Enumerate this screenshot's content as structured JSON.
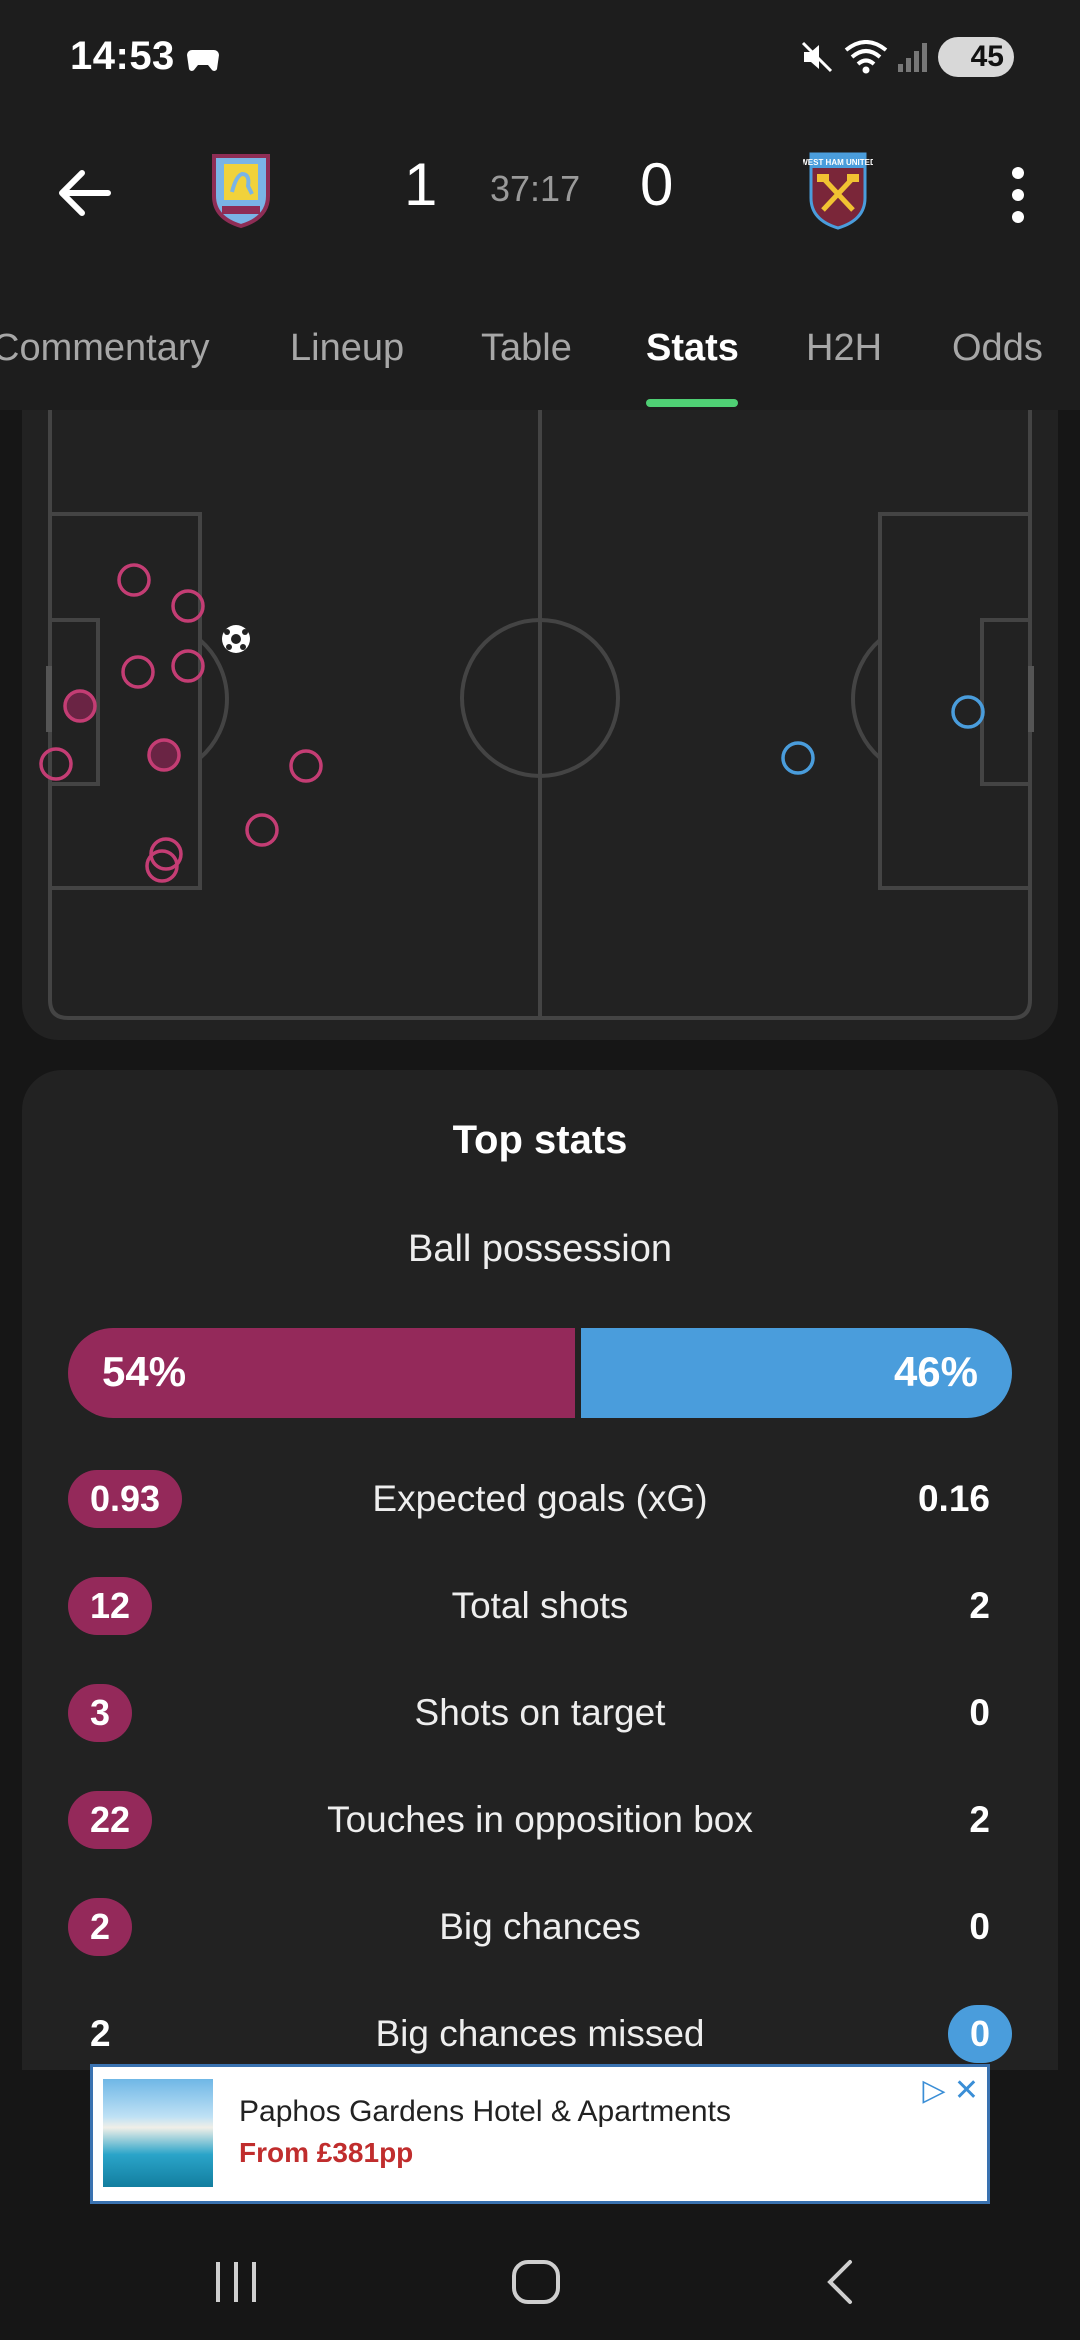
{
  "status_bar": {
    "time": "14:53",
    "battery": "45",
    "icons": [
      "game-controller-icon",
      "mute-icon",
      "wifi-icon",
      "signal-icon",
      "battery-icon"
    ]
  },
  "match": {
    "home_score": "1",
    "away_score": "0",
    "clock": "37:17",
    "home_crest": "aston-villa-crest-icon",
    "away_crest": "west-ham-crest-icon",
    "away_crest_text": "WEST HAM UNITED"
  },
  "tabs": [
    {
      "label": "Commentary"
    },
    {
      "label": "Lineup"
    },
    {
      "label": "Table"
    },
    {
      "label": "Stats",
      "active": true
    },
    {
      "label": "H2H"
    },
    {
      "label": "Odds"
    }
  ],
  "colors": {
    "home": "#94295a",
    "away": "#4a9ddc",
    "accent": "#4fcf74"
  },
  "shot_map": {
    "home_shots": 12,
    "away_shots": 2,
    "goal_marker": "football-icon"
  },
  "top_stats": {
    "title": "Top stats",
    "possession": {
      "label": "Ball possession",
      "home": "54%",
      "away": "46%",
      "home_fraction": 0.54
    },
    "rows": [
      {
        "label": "Expected goals (xG)",
        "home": "0.93",
        "away": "0.16",
        "highlight": "home"
      },
      {
        "label": "Total shots",
        "home": "12",
        "away": "2",
        "highlight": "home"
      },
      {
        "label": "Shots on target",
        "home": "3",
        "away": "0",
        "highlight": "home"
      },
      {
        "label": "Touches in opposition box",
        "home": "22",
        "away": "2",
        "highlight": "home"
      },
      {
        "label": "Big chances",
        "home": "2",
        "away": "0",
        "highlight": "home"
      },
      {
        "label": "Big chances missed",
        "home": "2",
        "away": "0",
        "highlight": "away"
      }
    ]
  },
  "ad": {
    "title": "Paphos Gardens Hotel & Apartments",
    "price": "From £381pp"
  }
}
